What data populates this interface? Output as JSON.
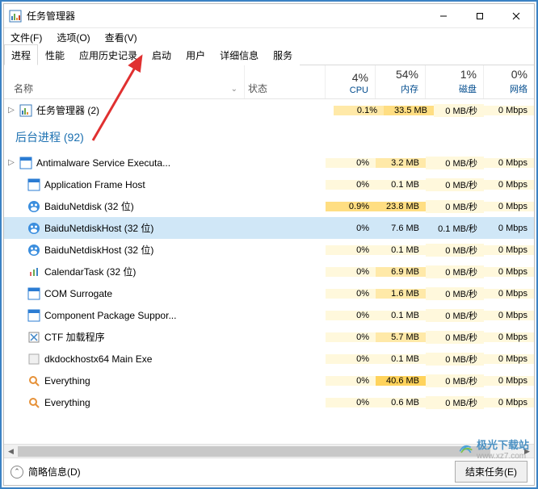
{
  "window": {
    "title": "任务管理器"
  },
  "menu": {
    "file": "文件(F)",
    "options": "选项(O)",
    "view": "查看(V)"
  },
  "tabs": {
    "processes": "进程",
    "performance": "性能",
    "app_history": "应用历史记录",
    "startup": "启动",
    "users": "用户",
    "details": "详细信息",
    "services": "服务"
  },
  "columns": {
    "name": "名称",
    "status": "状态",
    "cpu_pct": "4%",
    "cpu_label": "CPU",
    "mem_pct": "54%",
    "mem_label": "内存",
    "disk_pct": "1%",
    "disk_label": "磁盘",
    "net_pct": "0%",
    "net_label": "网络"
  },
  "apps": {
    "task_manager": {
      "name": "任务管理器 (2)",
      "cpu": "0.1%",
      "mem": "33.5 MB",
      "disk": "0 MB/秒",
      "net": "0 Mbps"
    }
  },
  "group": {
    "bg_label": "后台进程 (92)"
  },
  "rows": [
    {
      "name": "Antimalware Service Executa...",
      "cpu": "0%",
      "mem": "3.2 MB",
      "disk": "0 MB/秒",
      "net": "0 Mbps",
      "exp": true,
      "icon": "winapp"
    },
    {
      "name": "Application Frame Host",
      "cpu": "0%",
      "mem": "0.1 MB",
      "disk": "0 MB/秒",
      "net": "0 Mbps",
      "exp": false,
      "icon": "winapp"
    },
    {
      "name": "BaiduNetdisk (32 位)",
      "cpu": "0.9%",
      "mem": "23.8 MB",
      "disk": "0 MB/秒",
      "net": "0 Mbps",
      "exp": false,
      "icon": "baidu"
    },
    {
      "name": "BaiduNetdiskHost (32 位)",
      "cpu": "0%",
      "mem": "7.6 MB",
      "disk": "0.1 MB/秒",
      "net": "0 Mbps",
      "exp": false,
      "icon": "baidu",
      "selected": true
    },
    {
      "name": "BaiduNetdiskHost (32 位)",
      "cpu": "0%",
      "mem": "0.1 MB",
      "disk": "0 MB/秒",
      "net": "0 Mbps",
      "exp": false,
      "icon": "baidu"
    },
    {
      "name": "CalendarTask (32 位)",
      "cpu": "0%",
      "mem": "6.9 MB",
      "disk": "0 MB/秒",
      "net": "0 Mbps",
      "exp": false,
      "icon": "calendar"
    },
    {
      "name": "COM Surrogate",
      "cpu": "0%",
      "mem": "1.6 MB",
      "disk": "0 MB/秒",
      "net": "0 Mbps",
      "exp": false,
      "icon": "winapp"
    },
    {
      "name": "Component Package Suppor...",
      "cpu": "0%",
      "mem": "0.1 MB",
      "disk": "0 MB/秒",
      "net": "0 Mbps",
      "exp": false,
      "icon": "winapp"
    },
    {
      "name": "CTF 加载程序",
      "cpu": "0%",
      "mem": "5.7 MB",
      "disk": "0 MB/秒",
      "net": "0 Mbps",
      "exp": false,
      "icon": "ctf"
    },
    {
      "name": "dkdockhostx64 Main Exe",
      "cpu": "0%",
      "mem": "0.1 MB",
      "disk": "0 MB/秒",
      "net": "0 Mbps",
      "exp": false,
      "icon": "generic"
    },
    {
      "name": "Everything",
      "cpu": "0%",
      "mem": "40.6 MB",
      "disk": "0 MB/秒",
      "net": "0 Mbps",
      "exp": false,
      "icon": "everything"
    },
    {
      "name": "Everything",
      "cpu": "0%",
      "mem": "0.6 MB",
      "disk": "0 MB/秒",
      "net": "0 Mbps",
      "exp": false,
      "icon": "everything"
    }
  ],
  "footer": {
    "less_details": "简略信息(D)",
    "end_task": "结束任务(E)"
  },
  "watermark": {
    "brand": "极光下载站",
    "url": "www.xz7.com"
  }
}
